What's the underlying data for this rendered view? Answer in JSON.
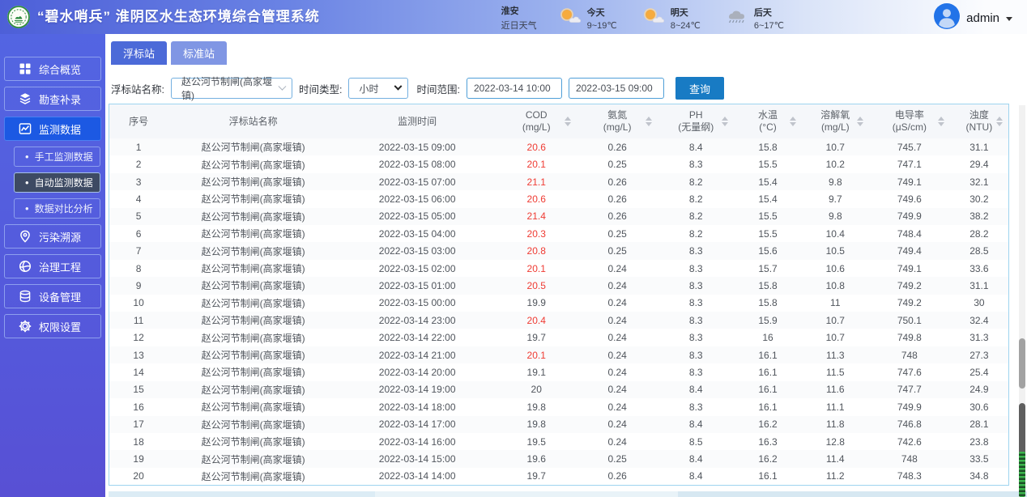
{
  "header": {
    "title": "“碧水哨兵” 淮阴区水生态环境综合管理系统",
    "weather": {
      "city": "淮安",
      "city_sub": "近日天气",
      "days": [
        {
          "label": "今天",
          "temp": "9~19℃",
          "icon": "sunny-icon"
        },
        {
          "label": "明天",
          "temp": "8~24℃",
          "icon": "sunny-icon"
        },
        {
          "label": "后天",
          "temp": "6~17℃",
          "icon": "rain-icon"
        }
      ]
    },
    "user": {
      "name": "admin"
    }
  },
  "sidebar": {
    "items": [
      {
        "label": "综合概览",
        "icon": "grid-icon",
        "active": false
      },
      {
        "label": "勘查补录",
        "icon": "layers-icon",
        "active": false
      },
      {
        "label": "监测数据",
        "icon": "chart-icon",
        "active": true,
        "children": [
          {
            "label": "手工监测数据",
            "active": false
          },
          {
            "label": "自动监测数据",
            "active": true
          },
          {
            "label": "数据对比分析",
            "active": false
          }
        ]
      },
      {
        "label": "污染溯源",
        "icon": "pin-icon",
        "active": false
      },
      {
        "label": "治理工程",
        "icon": "globe-icon",
        "active": false
      },
      {
        "label": "设备管理",
        "icon": "database-icon",
        "active": false
      },
      {
        "label": "权限设置",
        "icon": "gear-icon",
        "active": false
      }
    ]
  },
  "tabs": [
    {
      "label": "浮标站",
      "active": true
    },
    {
      "label": "标准站",
      "active": false
    }
  ],
  "filters": {
    "station_label": "浮标站名称:",
    "station_value": "赵公河节制闸(高家堰镇)",
    "time_type_label": "时间类型:",
    "time_type_value": "小时",
    "time_range_label": "时间范围:",
    "time_start": "2022-03-14 10:00",
    "time_end": "2022-03-15 09:00",
    "search_label": "查询"
  },
  "table": {
    "columns": [
      {
        "name": "序号",
        "unit": "",
        "sortable": false
      },
      {
        "name": "浮标站名称",
        "unit": "",
        "sortable": false
      },
      {
        "name": "监测时间",
        "unit": "",
        "sortable": false
      },
      {
        "name": "COD",
        "unit": "(mg/L)",
        "sortable": true
      },
      {
        "name": "氨氮",
        "unit": "(mg/L)",
        "sortable": true
      },
      {
        "name": "PH",
        "unit": "(无量纲)",
        "sortable": true
      },
      {
        "name": "水温",
        "unit": "(°C)",
        "sortable": true
      },
      {
        "name": "溶解氧",
        "unit": "(mg/L)",
        "sortable": true
      },
      {
        "name": "电导率",
        "unit": "(μS/cm)",
        "sortable": true
      },
      {
        "name": "浊度",
        "unit": "(NTU)",
        "sortable": true
      }
    ],
    "rows": [
      {
        "cells": [
          "1",
          "赵公河节制闸(高家堰镇)",
          "2022-03-15 09:00",
          "20.6",
          "0.26",
          "8.4",
          "15.8",
          "10.7",
          "745.7",
          "31.1"
        ],
        "cod_alert": true
      },
      {
        "cells": [
          "2",
          "赵公河节制闸(高家堰镇)",
          "2022-03-15 08:00",
          "20.1",
          "0.25",
          "8.3",
          "15.5",
          "10.2",
          "747.1",
          "29.4"
        ],
        "cod_alert": true
      },
      {
        "cells": [
          "3",
          "赵公河节制闸(高家堰镇)",
          "2022-03-15 07:00",
          "21.1",
          "0.26",
          "8.2",
          "15.4",
          "9.8",
          "749.1",
          "32.1"
        ],
        "cod_alert": true
      },
      {
        "cells": [
          "4",
          "赵公河节制闸(高家堰镇)",
          "2022-03-15 06:00",
          "20.6",
          "0.26",
          "8.2",
          "15.4",
          "9.7",
          "749.6",
          "30.2"
        ],
        "cod_alert": true
      },
      {
        "cells": [
          "5",
          "赵公河节制闸(高家堰镇)",
          "2022-03-15 05:00",
          "21.4",
          "0.26",
          "8.2",
          "15.5",
          "9.8",
          "749.9",
          "38.2"
        ],
        "cod_alert": true
      },
      {
        "cells": [
          "6",
          "赵公河节制闸(高家堰镇)",
          "2022-03-15 04:00",
          "20.3",
          "0.25",
          "8.2",
          "15.5",
          "10.4",
          "748.4",
          "28.2"
        ],
        "cod_alert": true
      },
      {
        "cells": [
          "7",
          "赵公河节制闸(高家堰镇)",
          "2022-03-15 03:00",
          "20.8",
          "0.25",
          "8.3",
          "15.6",
          "10.5",
          "749.4",
          "28.5"
        ],
        "cod_alert": true
      },
      {
        "cells": [
          "8",
          "赵公河节制闸(高家堰镇)",
          "2022-03-15 02:00",
          "20.1",
          "0.24",
          "8.3",
          "15.7",
          "10.6",
          "749.1",
          "33.6"
        ],
        "cod_alert": true
      },
      {
        "cells": [
          "9",
          "赵公河节制闸(高家堰镇)",
          "2022-03-15 01:00",
          "20.5",
          "0.24",
          "8.3",
          "15.8",
          "10.8",
          "749.2",
          "31.1"
        ],
        "cod_alert": true
      },
      {
        "cells": [
          "10",
          "赵公河节制闸(高家堰镇)",
          "2022-03-15 00:00",
          "19.9",
          "0.24",
          "8.3",
          "15.8",
          "11",
          "749.2",
          "30"
        ],
        "cod_alert": false
      },
      {
        "cells": [
          "11",
          "赵公河节制闸(高家堰镇)",
          "2022-03-14 23:00",
          "20.4",
          "0.24",
          "8.3",
          "15.9",
          "10.7",
          "750.1",
          "32.4"
        ],
        "cod_alert": true
      },
      {
        "cells": [
          "12",
          "赵公河节制闸(高家堰镇)",
          "2022-03-14 22:00",
          "19.7",
          "0.24",
          "8.3",
          "16",
          "10.7",
          "749.8",
          "31.3"
        ],
        "cod_alert": false
      },
      {
        "cells": [
          "13",
          "赵公河节制闸(高家堰镇)",
          "2022-03-14 21:00",
          "20.1",
          "0.24",
          "8.3",
          "16.1",
          "11.3",
          "748",
          "27.3"
        ],
        "cod_alert": true
      },
      {
        "cells": [
          "14",
          "赵公河节制闸(高家堰镇)",
          "2022-03-14 20:00",
          "19.1",
          "0.24",
          "8.3",
          "16.1",
          "11.5",
          "747.6",
          "25.4"
        ],
        "cod_alert": false
      },
      {
        "cells": [
          "15",
          "赵公河节制闸(高家堰镇)",
          "2022-03-14 19:00",
          "20",
          "0.24",
          "8.4",
          "16.1",
          "11.6",
          "747.7",
          "24.9"
        ],
        "cod_alert": false
      },
      {
        "cells": [
          "16",
          "赵公河节制闸(高家堰镇)",
          "2022-03-14 18:00",
          "19.8",
          "0.24",
          "8.3",
          "16.1",
          "11.1",
          "749.9",
          "30.6"
        ],
        "cod_alert": false
      },
      {
        "cells": [
          "17",
          "赵公河节制闸(高家堰镇)",
          "2022-03-14 17:00",
          "19.8",
          "0.24",
          "8.4",
          "16.2",
          "11.8",
          "746.8",
          "28.1"
        ],
        "cod_alert": false
      },
      {
        "cells": [
          "18",
          "赵公河节制闸(高家堰镇)",
          "2022-03-14 16:00",
          "19.5",
          "0.24",
          "8.5",
          "16.3",
          "12.8",
          "742.6",
          "23.8"
        ],
        "cod_alert": false
      },
      {
        "cells": [
          "19",
          "赵公河节制闸(高家堰镇)",
          "2022-03-14 15:00",
          "19.6",
          "0.25",
          "8.4",
          "16.2",
          "11.4",
          "748",
          "33.5"
        ],
        "cod_alert": false
      },
      {
        "cells": [
          "20",
          "赵公河节制闸(高家堰镇)",
          "2022-03-14 14:00",
          "19.7",
          "0.26",
          "8.4",
          "16.1",
          "11.2",
          "748.3",
          "34.8"
        ],
        "cod_alert": false
      }
    ]
  },
  "colors": {
    "accent_blue": "#4c6ad8",
    "active_menu": "#1c59e3",
    "query_button": "#187bc4",
    "alert_red": "#ef3b33",
    "table_border": "#9ed4ef"
  }
}
